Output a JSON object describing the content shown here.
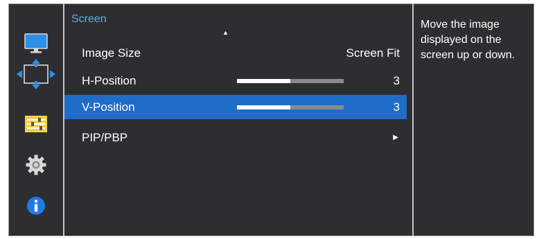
{
  "sidebar": {
    "icons": [
      "monitor-icon",
      "move-arrows-icon",
      "settings-sliders-icon",
      "gear-icon",
      "info-icon"
    ],
    "selected_index": 1
  },
  "menu": {
    "title": "Screen",
    "items": [
      {
        "label": "Image Size",
        "value": "Screen Fit"
      },
      {
        "label": "H-Position",
        "value": "3",
        "level": 0.5
      },
      {
        "label": "V-Position",
        "value": "3",
        "level": 0.5,
        "selected": true
      },
      {
        "label": "PIP/PBP",
        "has_submenu": true
      }
    ]
  },
  "help": {
    "text": "Move the image displayed on the screen up or down."
  },
  "colors": {
    "background": "#2e2e31",
    "accent": "#1f6cc9",
    "title": "#58aeea",
    "bar_track": "#8a8a8a",
    "bar_fill": "#ffffff"
  }
}
